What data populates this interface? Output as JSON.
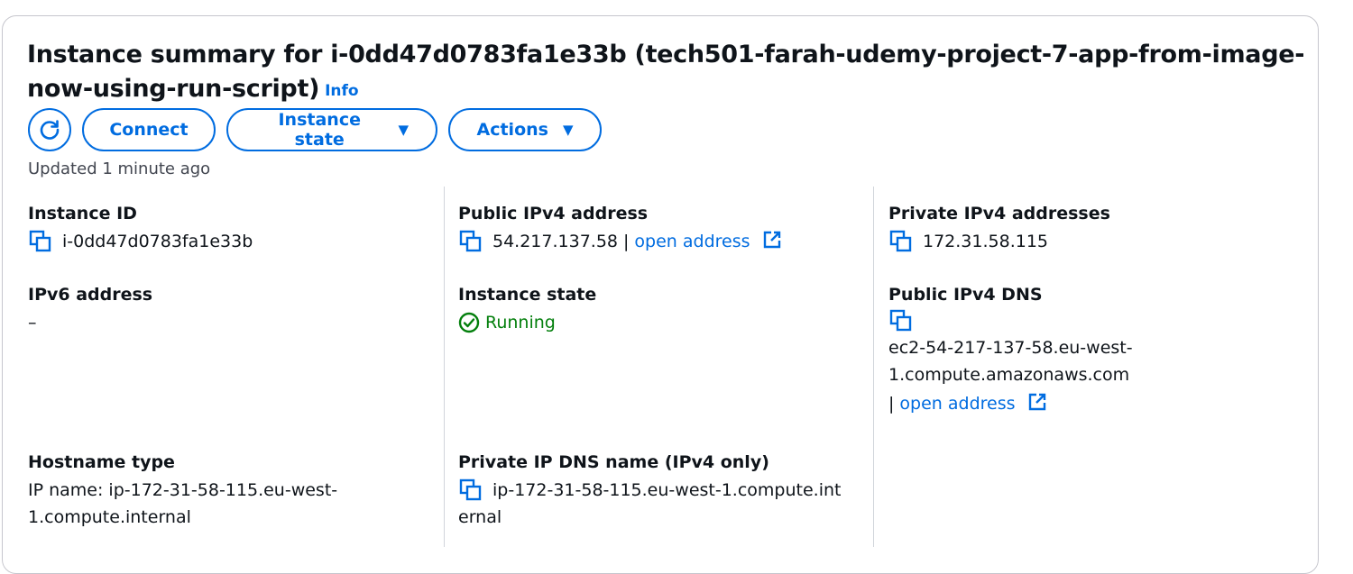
{
  "header": {
    "title": "Instance summary for i-0dd47d0783fa1e33b (tech501-farah-udemy-project-7-app-from-image-now-using-run-script)",
    "info_label": "Info"
  },
  "actions": {
    "refresh_icon": "refresh-icon",
    "connect_label": "Connect",
    "instance_state_label": "Instance state",
    "actions_label": "Actions"
  },
  "updated_text": "Updated 1 minute ago",
  "fields": {
    "instance_id": {
      "label": "Instance ID",
      "value": "i-0dd47d0783fa1e33b"
    },
    "public_ipv4": {
      "label": "Public IPv4 address",
      "value": "54.217.137.58",
      "separator": "|",
      "link": "open address"
    },
    "private_ipv4": {
      "label": "Private IPv4 addresses",
      "value": "172.31.58.115"
    },
    "ipv6": {
      "label": "IPv6 address",
      "value": "–"
    },
    "instance_state": {
      "label": "Instance state",
      "value": "Running"
    },
    "public_dns": {
      "label": "Public IPv4 DNS",
      "value_line1": "ec2-54-217-137-58.eu-west-",
      "value_line2": "1.compute.amazonaws.com",
      "separator": "|",
      "link": "open address"
    },
    "hostname_type": {
      "label": "Hostname type",
      "value_line1": "IP name: ip-172-31-58-115.eu-west-",
      "value_line2": "1.compute.internal"
    },
    "private_dns": {
      "label": "Private IP DNS name (IPv4 only)",
      "value_line1": "ip-172-31-58-115.eu-west-1.compute.int",
      "value_line2": "ernal"
    }
  },
  "colors": {
    "accent": "#006ce0",
    "success": "#037f0c",
    "border": "#c6c6cd",
    "text": "#0f141a",
    "muted": "#424650"
  }
}
